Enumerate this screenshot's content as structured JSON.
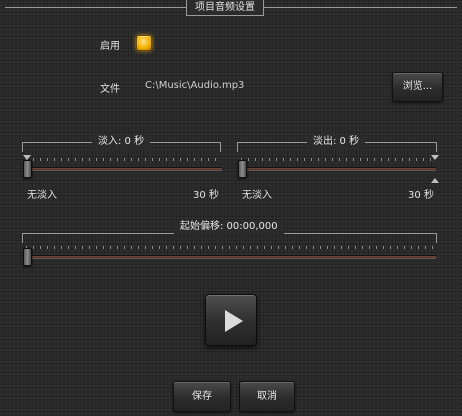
{
  "dialog": {
    "title": "项目音频设置"
  },
  "enable": {
    "label": "启用",
    "checked": true
  },
  "file": {
    "label": "文件",
    "path": "C:\\Music\\Audio.mp3",
    "browse_label": "浏览..."
  },
  "fade_in": {
    "caption": "淡入: 0 秒",
    "value_seconds": 0,
    "max_seconds": 30,
    "min_label": "无淡入",
    "max_label": "30 秒"
  },
  "fade_out": {
    "caption": "淡出: 0 秒",
    "value_seconds": 0,
    "max_seconds": 30,
    "min_label": "无淡入",
    "max_label": "30 秒"
  },
  "start_offset": {
    "caption": "起始偏移: 00:00,000",
    "value": 0
  },
  "play": {
    "icon": "play-icon"
  },
  "footer": {
    "save_label": "保存",
    "cancel_label": "取消"
  }
}
